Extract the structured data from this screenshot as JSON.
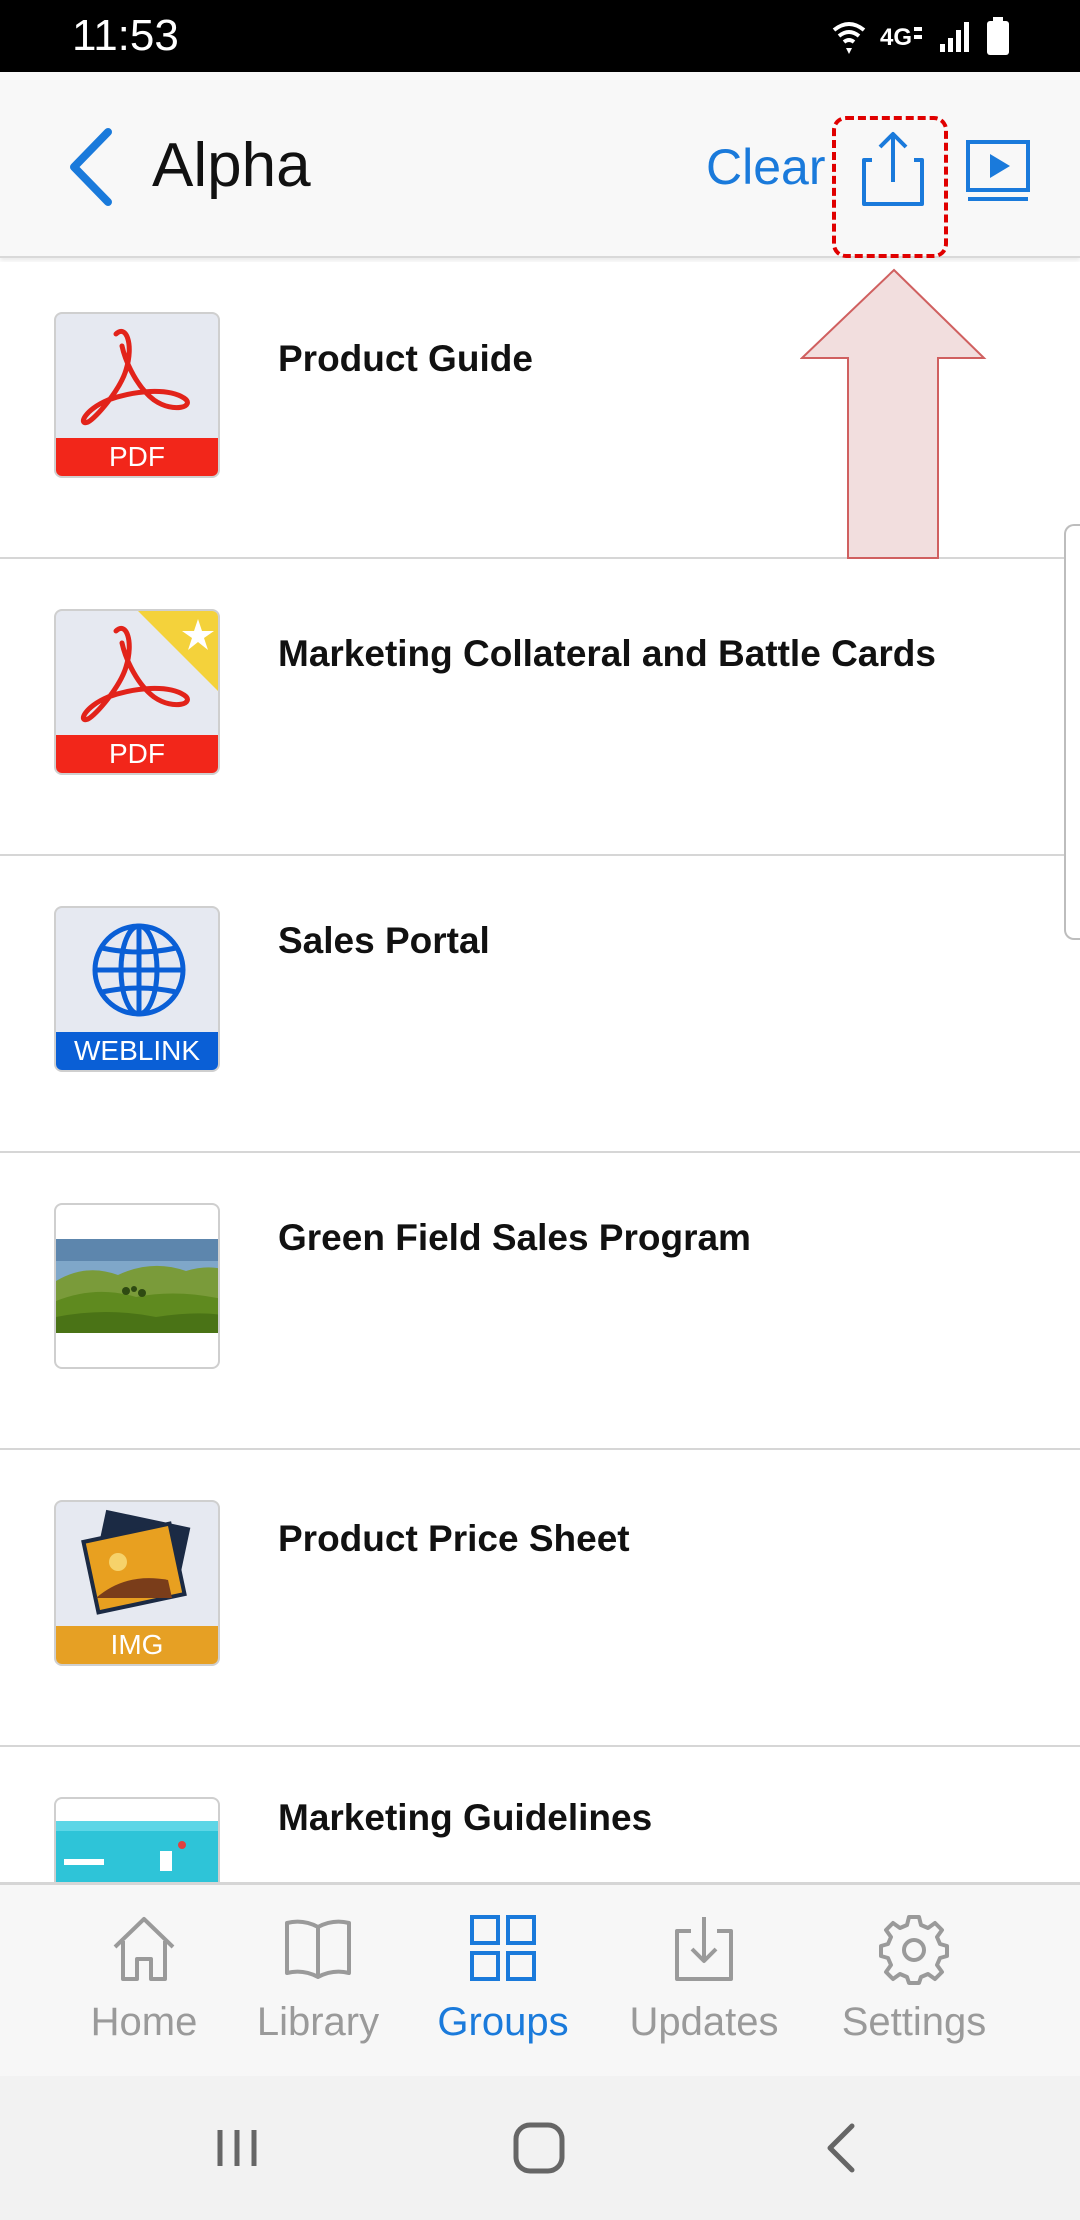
{
  "status_bar": {
    "time": "11:53",
    "icons": [
      "wifi-icon",
      "4g-icon",
      "signal-icon",
      "battery-icon"
    ]
  },
  "header": {
    "title": "Alpha",
    "clear_label": "Clear",
    "icons": [
      "back-icon",
      "share-icon",
      "present-icon"
    ]
  },
  "items": [
    {
      "title": "Product Guide",
      "type": "pdf",
      "badge": "PDF",
      "starred": false
    },
    {
      "title": "Marketing Collateral and Battle Cards",
      "type": "pdf",
      "badge": "PDF",
      "starred": true
    },
    {
      "title": "Sales Portal",
      "type": "weblink",
      "badge": "WEBLINK",
      "starred": false
    },
    {
      "title": "Green Field Sales Program",
      "type": "photo",
      "badge": "",
      "starred": false
    },
    {
      "title": "Product Price Sheet",
      "type": "img",
      "badge": "IMG",
      "starred": false
    },
    {
      "title": "Marketing Guidelines",
      "type": "image-preview",
      "badge": "",
      "starred": false
    }
  ],
  "tabs": [
    {
      "label": "Home",
      "icon": "home-icon",
      "active": false
    },
    {
      "label": "Library",
      "icon": "book-icon",
      "active": false
    },
    {
      "label": "Groups",
      "icon": "grid-icon",
      "active": true
    },
    {
      "label": "Updates",
      "icon": "download-icon",
      "active": false
    },
    {
      "label": "Settings",
      "icon": "gear-icon",
      "active": false
    }
  ],
  "colors": {
    "accent": "#1a7adb",
    "pdf_band": "#f2261a",
    "weblink_band": "#0a5fd6",
    "img_band": "#e6a024",
    "annotation_red": "#e00000",
    "arrow_fill": "#f2dede"
  }
}
